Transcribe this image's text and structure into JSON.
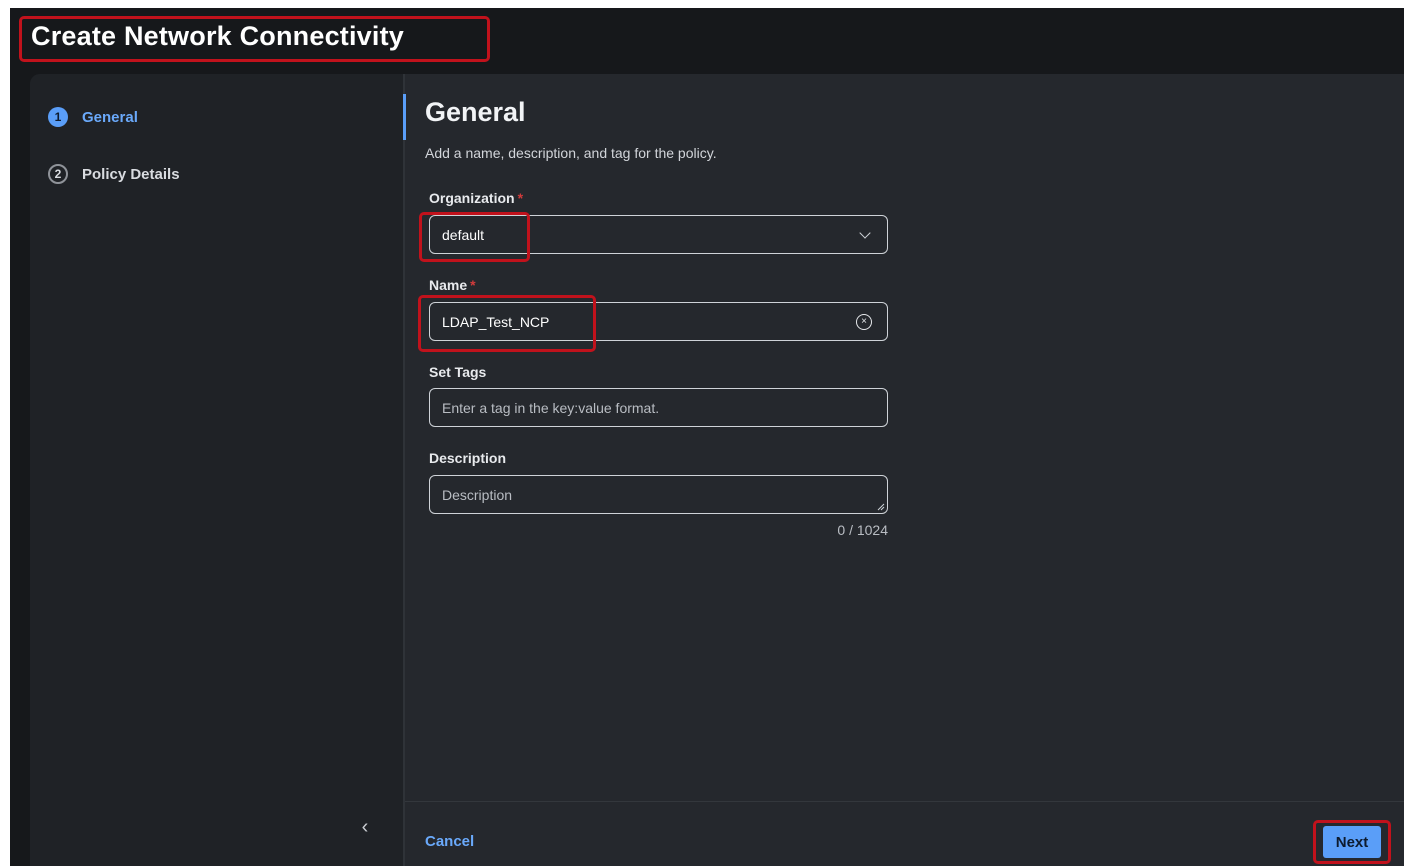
{
  "header": {
    "title": "Create Network Connectivity"
  },
  "stepper": {
    "steps": [
      {
        "number": "1",
        "label": "General",
        "state": "active"
      },
      {
        "number": "2",
        "label": "Policy Details",
        "state": "inactive"
      }
    ],
    "collapse_icon": "chevron-left-icon"
  },
  "section": {
    "title": "General",
    "subtitle": "Add a name, description, and tag for the policy."
  },
  "form": {
    "organization": {
      "label": "Organization",
      "required_mark": "*",
      "value": "default"
    },
    "name": {
      "label": "Name",
      "required_mark": "*",
      "value": "LDAP_Test_NCP"
    },
    "tags": {
      "label": "Set Tags",
      "placeholder": "Enter a tag in the key:value format."
    },
    "description": {
      "label": "Description",
      "placeholder": "Description",
      "counter": "0 / 1024"
    }
  },
  "footer": {
    "cancel_label": "Cancel",
    "next_label": "Next"
  },
  "colors": {
    "accent": "#5a9ef8",
    "highlight": "#c1121c",
    "background": "#16181b"
  }
}
